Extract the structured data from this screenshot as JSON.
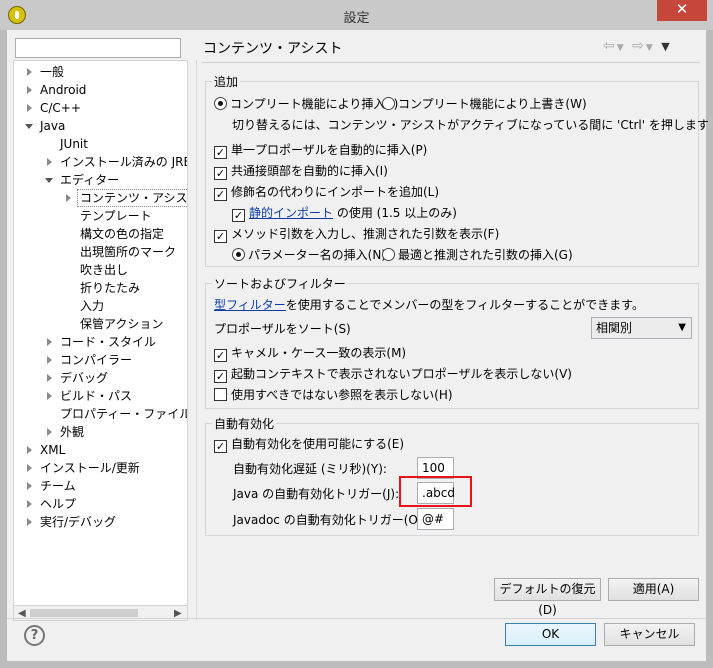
{
  "window": {
    "title": "設定",
    "close_glyph": "✕"
  },
  "filter": {
    "value": ""
  },
  "tree": [
    {
      "label": "一般"
    },
    {
      "label": "Android"
    },
    {
      "label": "C/C++"
    },
    {
      "label": "Java"
    },
    {
      "label": "JUnit"
    },
    {
      "label": "インストール済みの JRE"
    },
    {
      "label": "エディター"
    },
    {
      "label": "コンテンツ・アシスト"
    },
    {
      "label": "テンプレート"
    },
    {
      "label": "構文の色の指定"
    },
    {
      "label": "出現箇所のマーク"
    },
    {
      "label": "吹き出し"
    },
    {
      "label": "折りたたみ"
    },
    {
      "label": "入力"
    },
    {
      "label": "保管アクション"
    },
    {
      "label": "コード・スタイル"
    },
    {
      "label": "コンパイラー"
    },
    {
      "label": "デバッグ"
    },
    {
      "label": "ビルド・パス"
    },
    {
      "label": "プロパティー・ファイル・エディ"
    },
    {
      "label": "外観"
    },
    {
      "label": "XML"
    },
    {
      "label": "インストール/更新"
    },
    {
      "label": "チーム"
    },
    {
      "label": "ヘルプ"
    },
    {
      "label": "実行/デバッグ"
    }
  ],
  "page": {
    "title": "コンテンツ・アシスト"
  },
  "insertion": {
    "legend": "追加",
    "radio_insert": "コンプリート機能により挿入(I)",
    "radio_overwrite": "コンプリート機能により上書き(W)",
    "hint": "切り替えるには、コンテンツ・アシストがアクティブになっている間に 'Ctrl' を押します",
    "cb_single": "単一プロポーザルを自動的に挿入(P)",
    "cb_prefix": "共通接頭部を自動的に挿入(I)",
    "cb_import": "修飾名の代わりにインポートを追加(L)",
    "static_link": "静的インポート",
    "static_rest": "の使用 (1.5 以上のみ)",
    "cb_method": "メソッド引数を入力し、推測された引数を表示(F)",
    "radio_param": "パラメーター名の挿入(N)",
    "radio_guess": "最適と推測された引数の挿入(G)"
  },
  "sorting": {
    "legend": "ソートおよびフィルター",
    "type_filter_link": "型フィルター",
    "type_filter_rest": "を使用することでメンバーの型をフィルターすることができます。",
    "sort_label": "プロポーザルをソート(S)",
    "sort_value": "相関別",
    "cb_camel": "キャメル・ケース一致の表示(M)",
    "cb_context": "起動コンテキストで表示されないプロポーザルを表示しない(V)",
    "cb_deprecated": "使用すべきではない参照を表示しない(H)"
  },
  "auto": {
    "legend": "自動有効化",
    "cb_enable": "自動有効化を使用可能にする(E)",
    "delay_label": "自動有効化遅延 (ミリ秒)(Y):",
    "delay_value": "100",
    "java_label": "Java の自動有効化トリガー(J):",
    "java_value": ".abcd",
    "javadoc_label": "Javadoc の自動有効化トリガー(O):",
    "javadoc_value": "@#"
  },
  "buttons": {
    "restore": "デフォルトの復元(D)",
    "apply": "適用(A)",
    "ok": "OK",
    "cancel": "キャンセル"
  },
  "icons": {
    "help": "?",
    "check": "✓"
  }
}
